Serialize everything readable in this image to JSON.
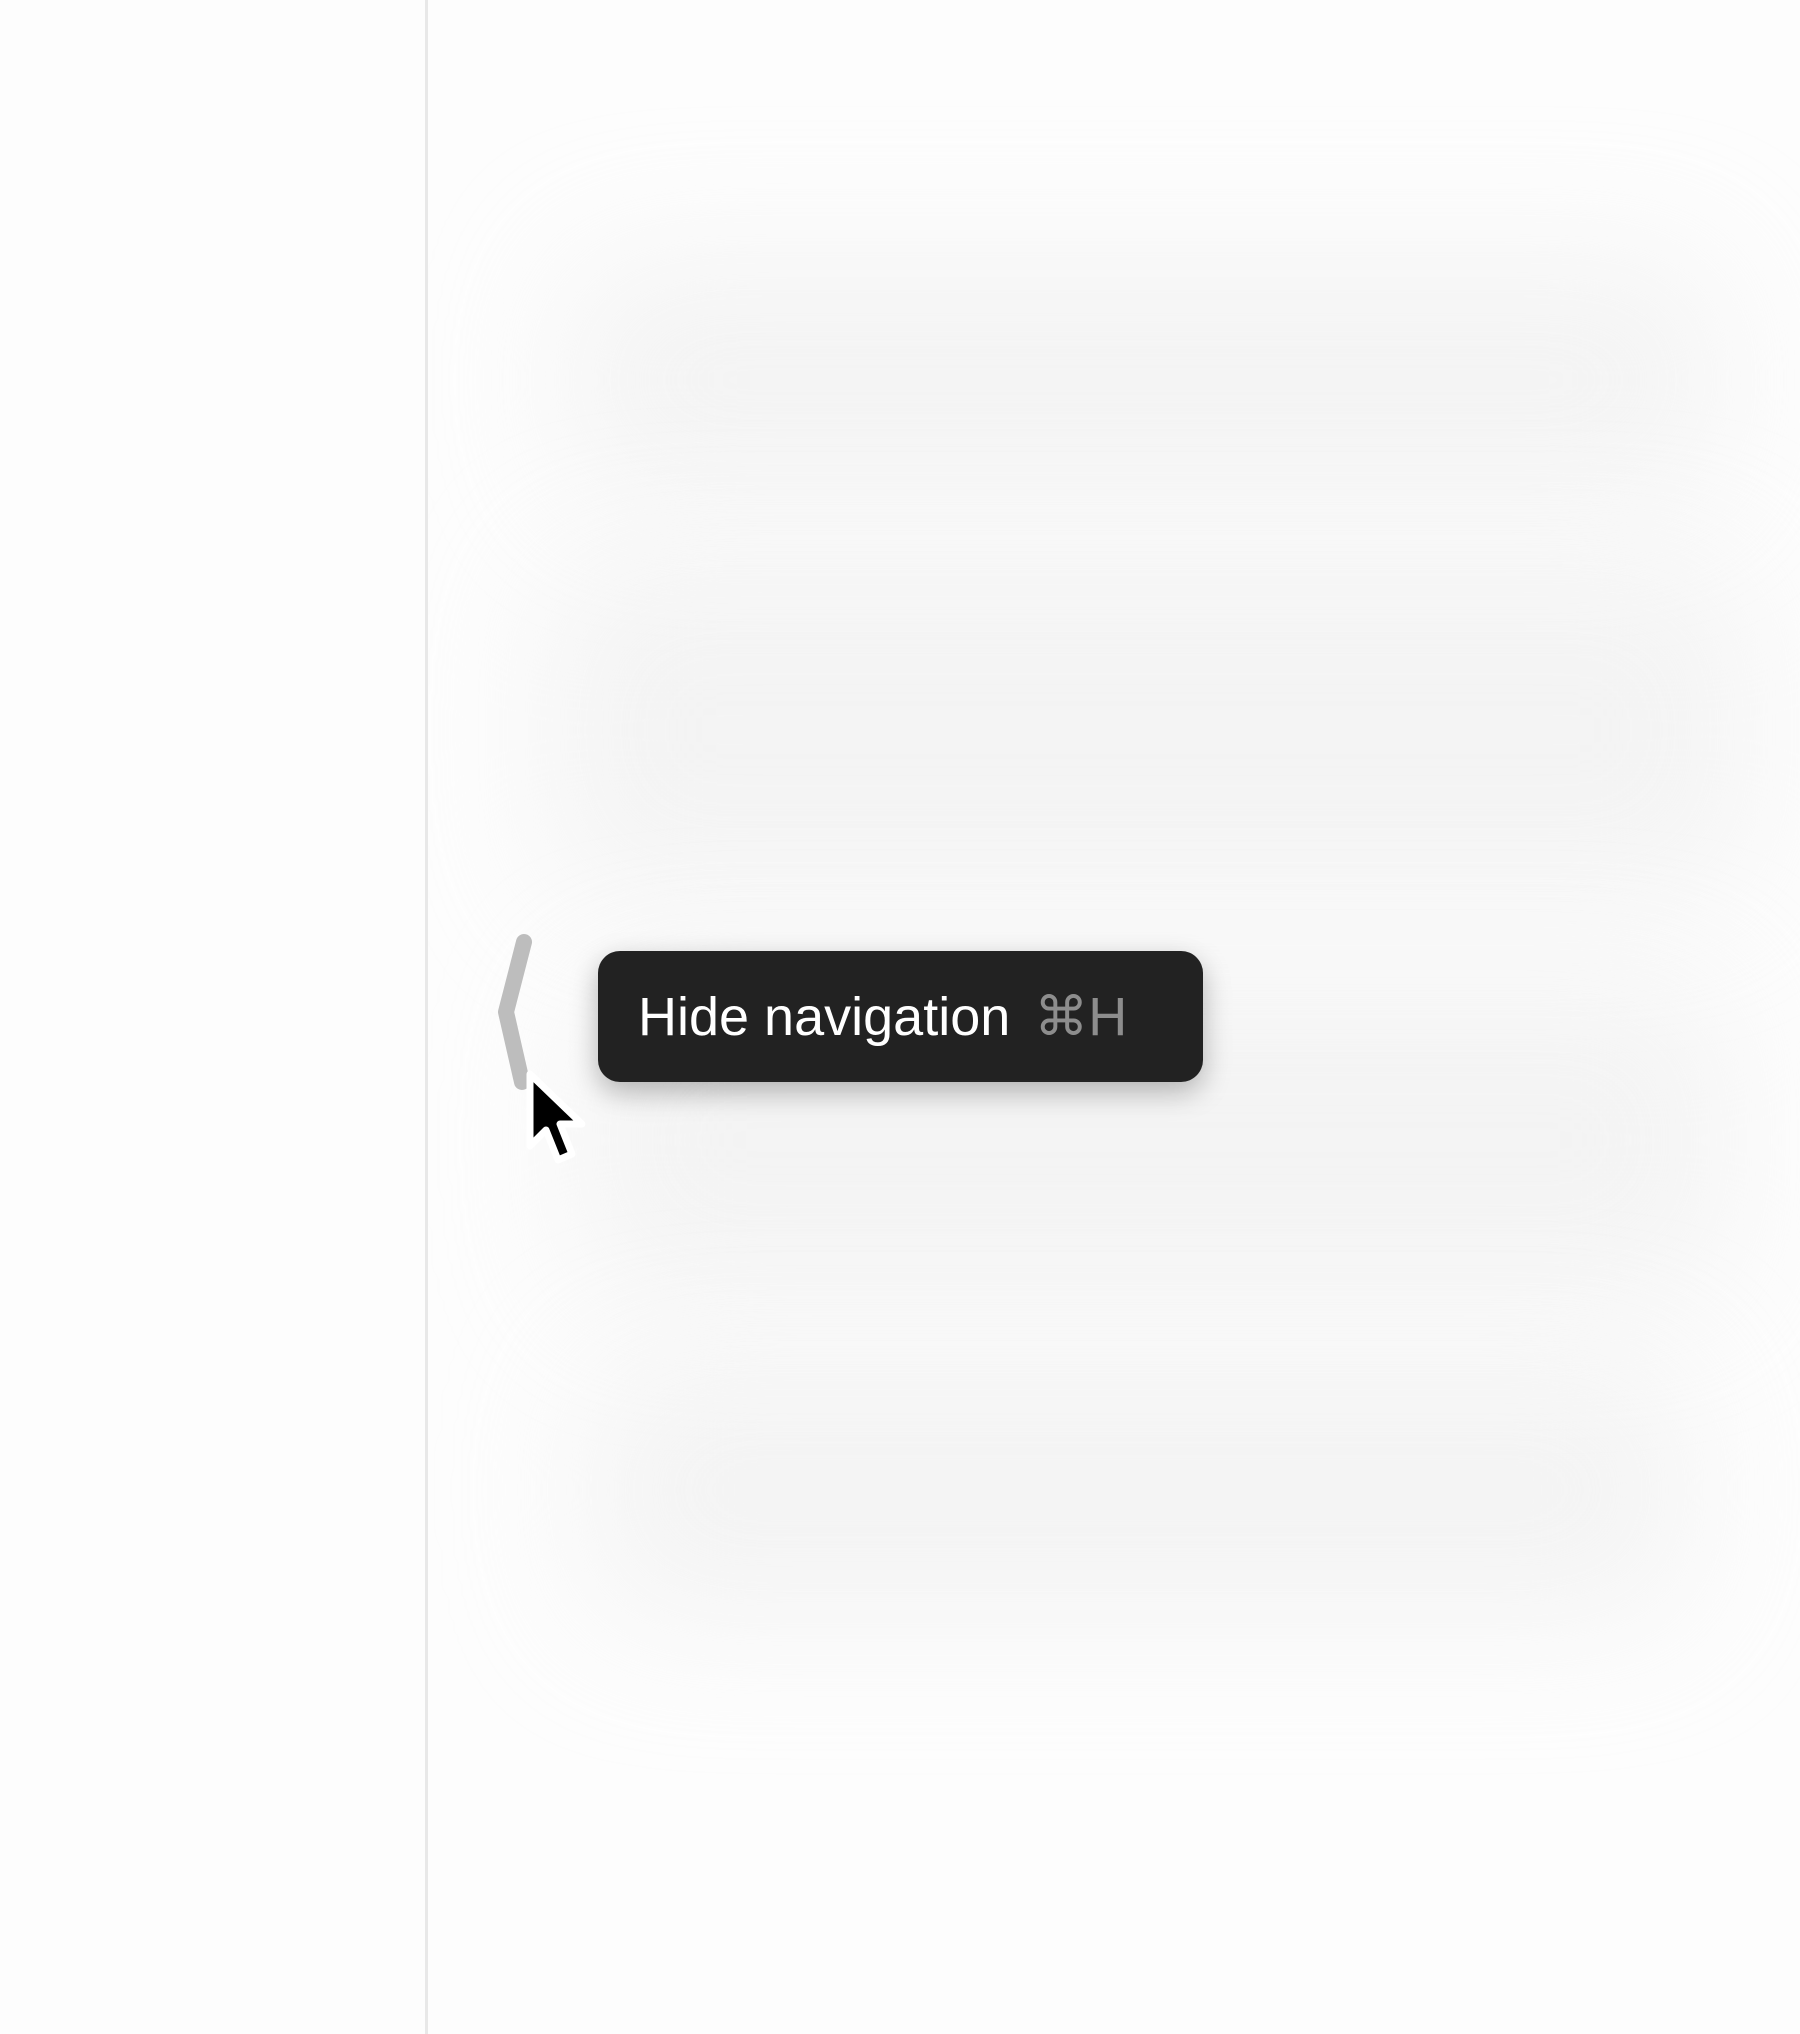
{
  "sidebar": {
    "divider_color": "#e8e8e8"
  },
  "main": {
    "background": "#fdfdfd"
  },
  "collapse_handle": {
    "icon": "chevron-left-icon",
    "color": "#bdbdbd"
  },
  "tooltip": {
    "label": "Hide navigation",
    "shortcut": "⌘H",
    "background": "#222222"
  },
  "cursor": {
    "icon": "arrow-pointer-icon"
  }
}
